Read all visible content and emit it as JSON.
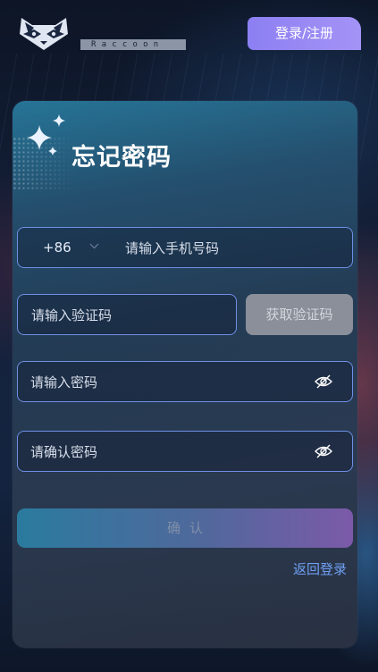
{
  "header": {
    "brand": "Raccoon",
    "login_register": "登录/注册",
    "logo_icon": "raccoon-logo-icon"
  },
  "form": {
    "title": "忘记密码",
    "sparkle_icon": "sparkle-icon",
    "country_code": "+86",
    "phone_placeholder": "请输入手机号码",
    "code_placeholder": "请输入验证码",
    "get_code": "获取验证码",
    "password_placeholder": "请输入密码",
    "confirm_password_placeholder": "请确认密码",
    "confirm": "确认",
    "back_to_login": "返回登录"
  },
  "colors": {
    "accent": "#8c7ff2",
    "field_border": "#6f8fe6",
    "link": "#6fa0f2"
  }
}
